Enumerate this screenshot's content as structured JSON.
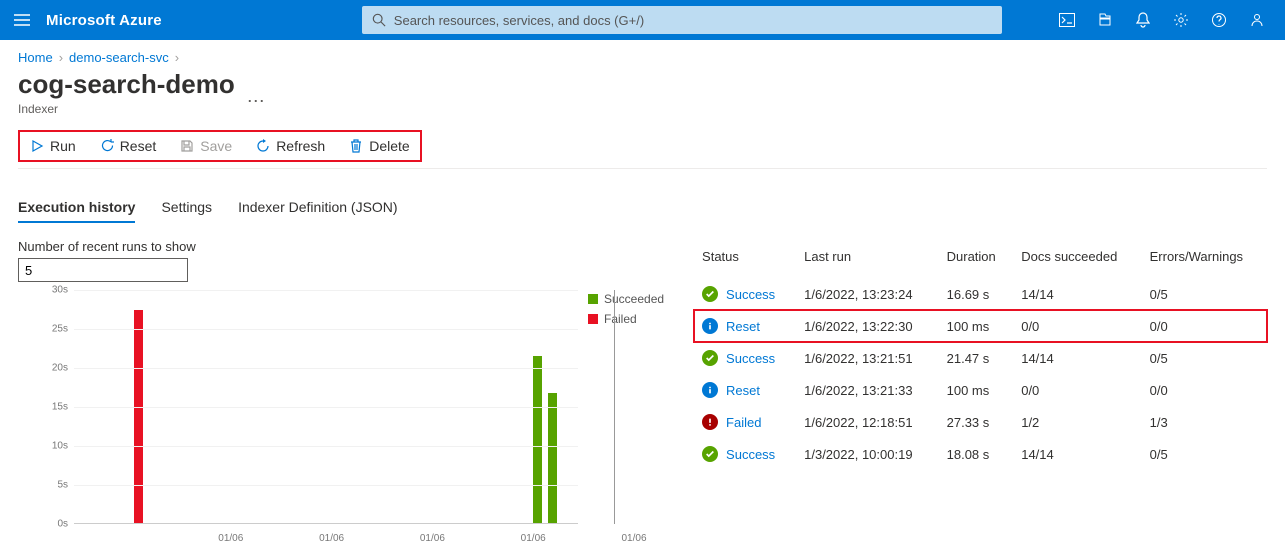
{
  "brand": "Microsoft Azure",
  "search": {
    "placeholder": "Search resources, services, and docs (G+/)"
  },
  "breadcrumbs": {
    "home": "Home",
    "svc": "demo-search-svc"
  },
  "page_title": "cog-search-demo",
  "page_subtitle": "Indexer",
  "toolbar": {
    "run": "Run",
    "reset": "Reset",
    "save": "Save",
    "refresh": "Refresh",
    "delete": "Delete"
  },
  "tabs": {
    "exec": "Execution history",
    "settings": "Settings",
    "json": "Indexer Definition (JSON)"
  },
  "runs_label": "Number of recent runs to show",
  "runs_value": "5",
  "legend": {
    "succeeded": "Succeeded",
    "failed": "Failed"
  },
  "table": {
    "headers": {
      "status": "Status",
      "last_run": "Last run",
      "duration": "Duration",
      "docs": "Docs succeeded",
      "errs": "Errors/Warnings"
    },
    "rows": [
      {
        "status": "Success",
        "icon": "ok",
        "last_run": "1/6/2022, 13:23:24",
        "duration": "16.69 s",
        "docs": "14/14",
        "errs": "0/5"
      },
      {
        "status": "Reset",
        "icon": "info",
        "last_run": "1/6/2022, 13:22:30",
        "duration": "100 ms",
        "docs": "0/0",
        "errs": "0/0",
        "hi": true
      },
      {
        "status": "Success",
        "icon": "ok",
        "last_run": "1/6/2022, 13:21:51",
        "duration": "21.47 s",
        "docs": "14/14",
        "errs": "0/5"
      },
      {
        "status": "Reset",
        "icon": "info",
        "last_run": "1/6/2022, 13:21:33",
        "duration": "100 ms",
        "docs": "0/0",
        "errs": "0/0"
      },
      {
        "status": "Failed",
        "icon": "err",
        "last_run": "1/6/2022, 12:18:51",
        "duration": "27.33 s",
        "docs": "1/2",
        "errs": "1/3"
      },
      {
        "status": "Success",
        "icon": "ok",
        "last_run": "1/3/2022, 10:00:19",
        "duration": "18.08 s",
        "docs": "14/14",
        "errs": "0/5"
      }
    ]
  },
  "chart_data": {
    "type": "bar",
    "ylabel": "seconds",
    "ylim": [
      0,
      30
    ],
    "yticks": [
      "0s",
      "5s",
      "10s",
      "15s",
      "20s",
      "25s",
      "30s"
    ],
    "xticks": [
      "01/06",
      "01/06",
      "01/06",
      "01/06",
      "01/06"
    ],
    "series": [
      {
        "name": "Succeeded",
        "color": "#57a300"
      },
      {
        "name": "Failed",
        "color": "#e81123"
      }
    ],
    "bars": [
      {
        "x_pct": 12,
        "value": 27.33,
        "series": "Failed"
      },
      {
        "x_pct": 91,
        "value": 21.47,
        "series": "Succeeded"
      },
      {
        "x_pct": 94,
        "value": 16.69,
        "series": "Succeeded"
      }
    ],
    "tracker_x_pct": 96.5
  }
}
